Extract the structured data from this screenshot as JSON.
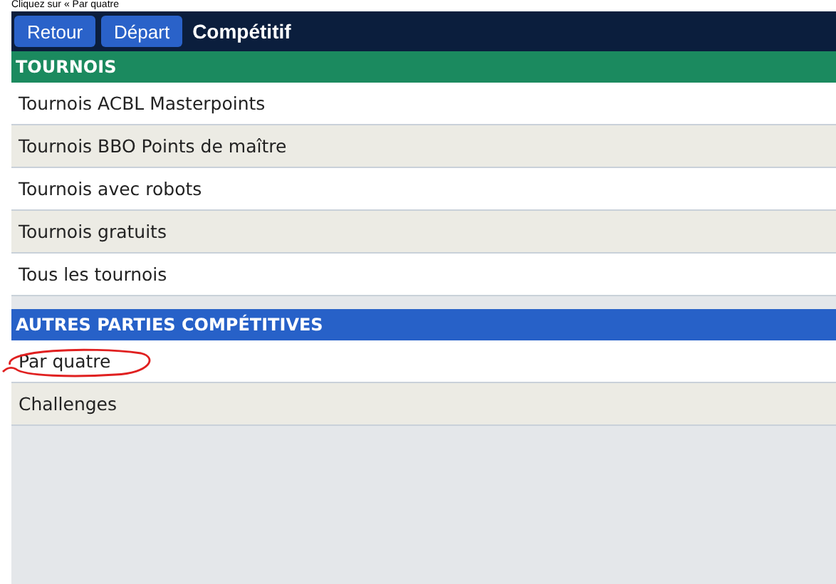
{
  "caption": "Cliquez sur « Par quatre",
  "header": {
    "buttons": [
      "Retour",
      "Départ"
    ],
    "title": "Compétitif"
  },
  "sections": [
    {
      "title": "TOURNOIS",
      "color": "#1b8a5f",
      "items": [
        {
          "label": "Tournois ACBL Masterpoints",
          "circled": false
        },
        {
          "label": "Tournois BBO Points de maître",
          "circled": false
        },
        {
          "label": "Tournois avec robots",
          "circled": false
        },
        {
          "label": "Tournois gratuits",
          "circled": false
        },
        {
          "label": "Tous les tournois",
          "circled": false
        }
      ]
    },
    {
      "title": "AUTRES PARTIES COMPÉTITIVES",
      "color": "#2761c8",
      "items": [
        {
          "label": "Par quatre",
          "circled": true
        },
        {
          "label": "Challenges",
          "circled": false
        }
      ]
    }
  ]
}
